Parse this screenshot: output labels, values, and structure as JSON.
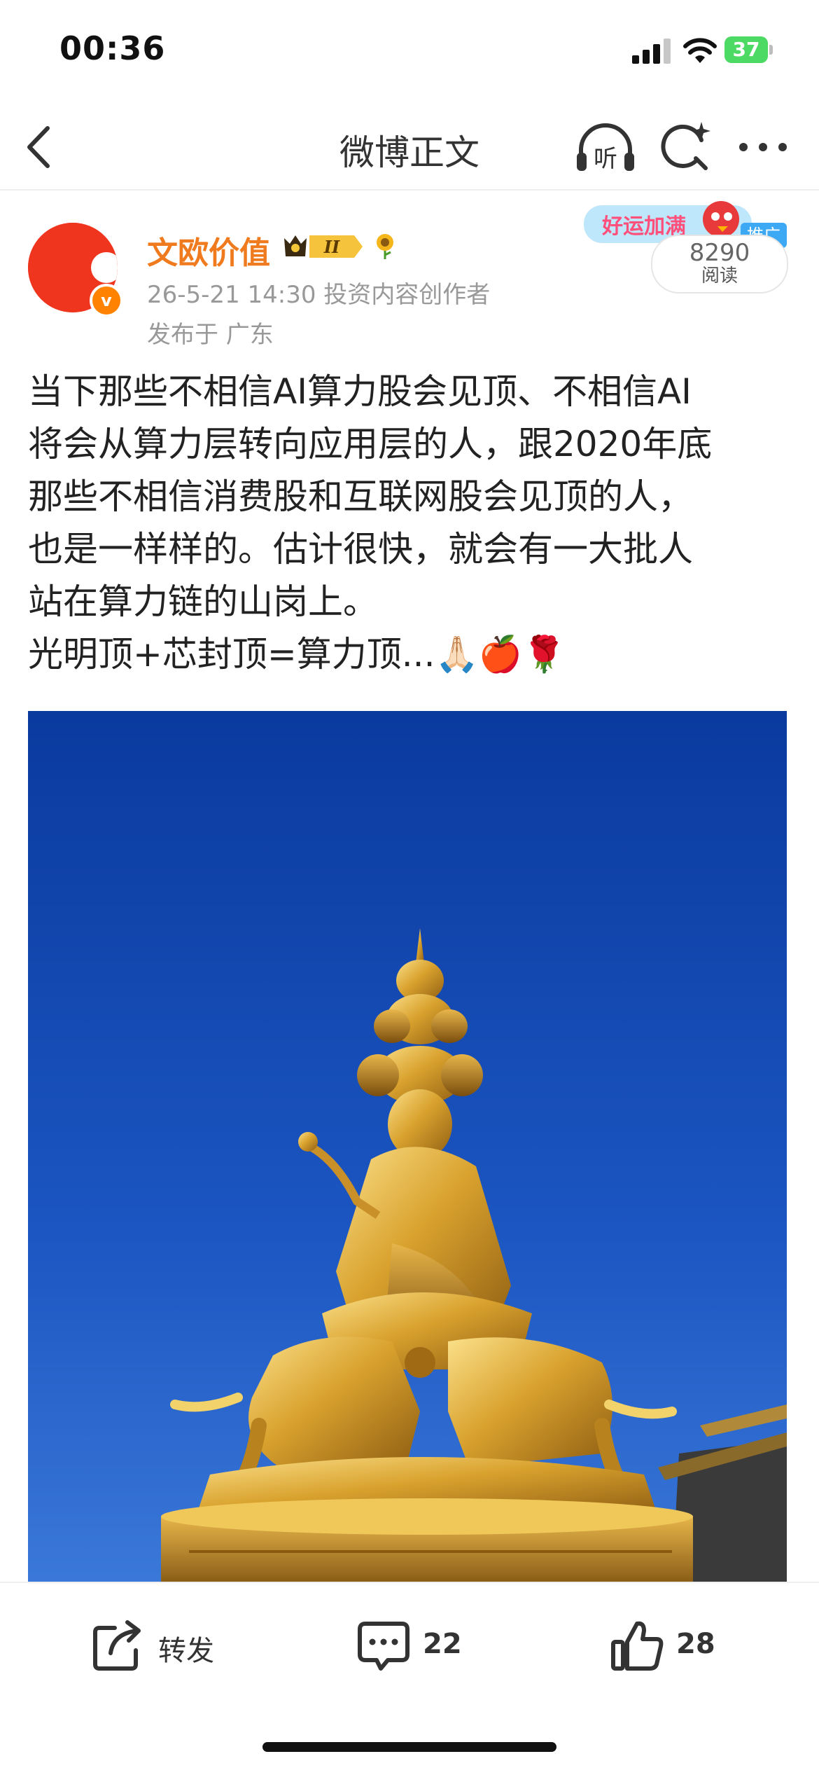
{
  "status_bar": {
    "time": "00:36",
    "battery": "37"
  },
  "nav": {
    "title": "微博正文",
    "listen_label": "听"
  },
  "author": {
    "name": "文欧价值",
    "level_badge": "II",
    "verified_mark": "v",
    "meta": "26-5-21 14:30  投资内容创作者",
    "location": "发布于 广东"
  },
  "ad": {
    "banner_text": "好运加满",
    "tag": "推广"
  },
  "reads": {
    "count": "8290",
    "label": "阅读"
  },
  "post": {
    "lines": [
      "当下那些不相信AI算力股会见顶、不相信AI",
      "将会从算力层转向应用层的人，跟2020年底",
      "那些不相信消费股和互联网股会见顶的人，",
      "也是一样样的。估计很快，就会有一大批人",
      "站在算力链的山岗上。",
      "光明顶+芯封顶=算力顶...🙏🏻🍎🌹"
    ]
  },
  "actions": {
    "repost_label": "转发",
    "comment_count": "22",
    "like_count": "28"
  },
  "colors": {
    "accent_orange": "#f07b1e",
    "avatar_red": "#f0351f",
    "sky_blue": "#0a3ea8",
    "gold": "#d4a02a"
  }
}
